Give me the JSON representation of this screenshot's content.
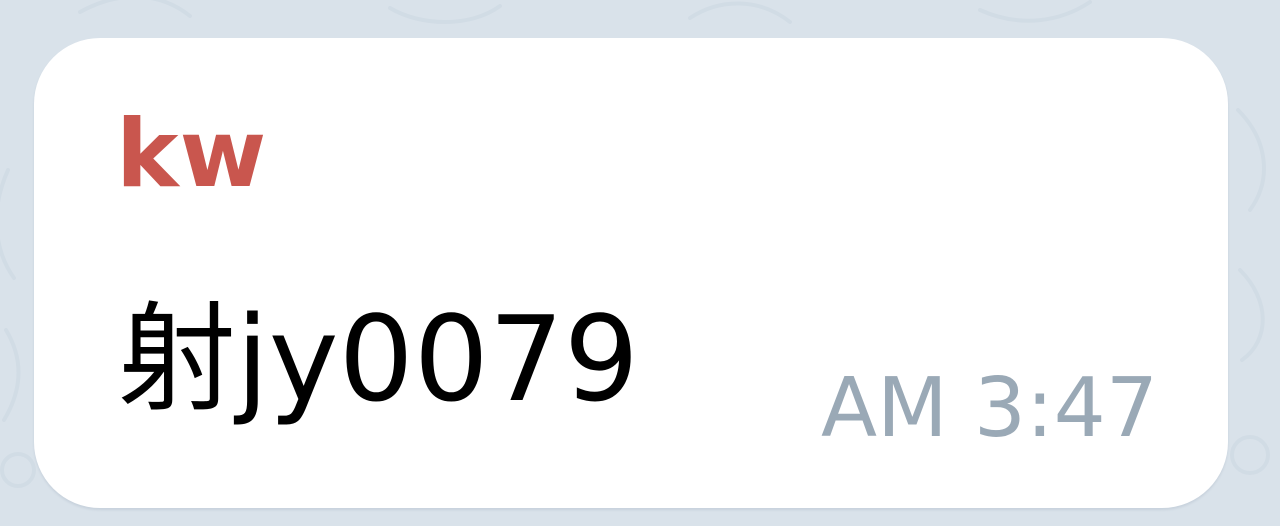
{
  "message": {
    "sender": "kw",
    "text": "射jy0079",
    "time": "AM 3:47"
  },
  "colors": {
    "chat_background": "#d9e2ea",
    "bubble_background": "#ffffff",
    "sender_name": "#c9564e",
    "message_text": "#000000",
    "timestamp": "#9aa9b6"
  }
}
